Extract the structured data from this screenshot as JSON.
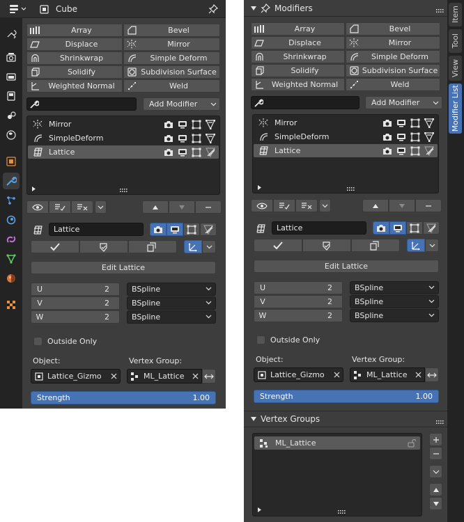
{
  "colors": {
    "panel_bg": "#3d3d3d",
    "header_bg": "#303030",
    "tab_bg": "#232323",
    "button": "#545454",
    "field_dark": "#1d1d1d",
    "list_bg": "#282828",
    "accent_blue": "#4772b3",
    "text": "#e6e6e6"
  },
  "left_panel": {
    "object_name": "Cube",
    "property_tabs": [
      "tool-icon",
      "render-icon",
      "output-icon",
      "view-layer-icon",
      "scene-icon",
      "world-icon",
      "object-icon",
      "modifier-icon",
      "particles-icon",
      "physics-icon",
      "constraints-icon",
      "data-icon",
      "material-icon",
      "texture-icon"
    ]
  },
  "modifier_buttons": [
    {
      "label": "Array",
      "icon": "array-icon"
    },
    {
      "label": "Bevel",
      "icon": "bevel-icon"
    },
    {
      "label": "Displace",
      "icon": "displace-icon"
    },
    {
      "label": "Mirror",
      "icon": "mirror-icon"
    },
    {
      "label": "Shrinkwrap",
      "icon": "shrinkwrap-icon"
    },
    {
      "label": "Simple Deform",
      "icon": "simple-deform-icon"
    },
    {
      "label": "Solidify",
      "icon": "solidify-icon"
    },
    {
      "label": "Subdivision Surface",
      "icon": "subsurf-icon"
    },
    {
      "label": "Weighted Normal",
      "icon": "weighted-normal-icon"
    },
    {
      "label": "Weld",
      "icon": "weld-icon"
    }
  ],
  "search": {
    "value": ""
  },
  "add_modifier": {
    "label": "Add Modifier"
  },
  "modifier_list": [
    {
      "name": "Mirror",
      "icon": "mirror-icon",
      "active": false
    },
    {
      "name": "SimpleDeform",
      "icon": "simple-deform-icon",
      "active": false
    },
    {
      "name": "Lattice",
      "icon": "lattice-icon",
      "active": true
    }
  ],
  "active_modifier": {
    "name": "Lattice",
    "edit_button": "Edit Lattice",
    "points": [
      {
        "axis": "U",
        "value": "2",
        "interp": "BSpline"
      },
      {
        "axis": "V",
        "value": "2",
        "interp": "BSpline"
      },
      {
        "axis": "W",
        "value": "2",
        "interp": "BSpline"
      }
    ],
    "outside_only_label": "Outside Only",
    "outside_only_checked": false,
    "object_label": "Object:",
    "object_value": "Lattice_Gizmo",
    "vertex_group_label": "Vertex Group:",
    "vertex_group_value": "ML_Lattice",
    "strength_label": "Strength",
    "strength_value": "1.00"
  },
  "right_panel": {
    "modifiers_title": "Modifiers",
    "vertex_groups_title": "Vertex Groups",
    "vertex_groups": [
      {
        "name": "ML_Lattice",
        "active": true
      }
    ],
    "side_tabs": [
      {
        "label": "Item",
        "active": false
      },
      {
        "label": "Tool",
        "active": false
      },
      {
        "label": "View",
        "active": false
      },
      {
        "label": "Modifier List",
        "active": true
      }
    ]
  }
}
